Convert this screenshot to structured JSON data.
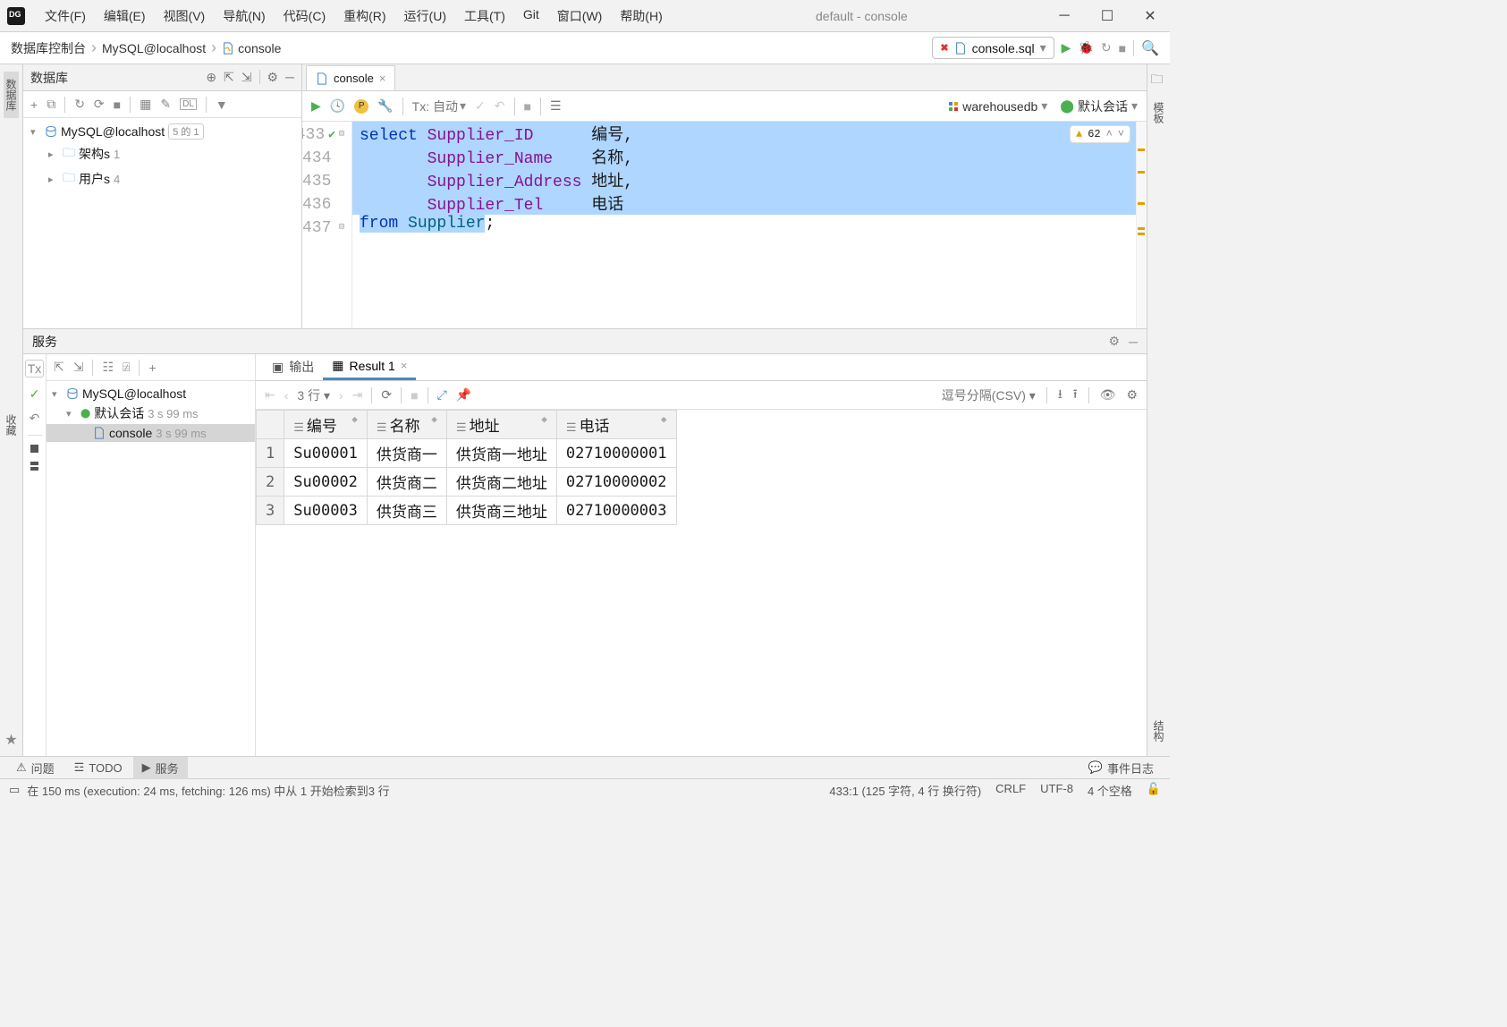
{
  "window": {
    "title": "default - console"
  },
  "menu": [
    "文件(F)",
    "编辑(E)",
    "视图(V)",
    "导航(N)",
    "代码(C)",
    "重构(R)",
    "运行(U)",
    "工具(T)",
    "Git",
    "窗口(W)",
    "帮助(H)"
  ],
  "breadcrumb": {
    "root": "数据库控制台",
    "db": "MySQL@localhost",
    "leaf": "console"
  },
  "file_dropdown": "console.sql",
  "left_rail": {
    "db": "数据库",
    "fav": "收藏"
  },
  "right_rail": {
    "tpl": "模板",
    "struct": "结构"
  },
  "db_panel": {
    "title": "数据库",
    "tree": {
      "conn": "MySQL@localhost",
      "conn_badge": "5 的 1",
      "schemas": "架构s",
      "schemas_count": "1",
      "users": "用户s",
      "users_count": "4"
    }
  },
  "editor": {
    "tab": "console",
    "tx_label": "Tx: 自动",
    "target_db": "warehousedb",
    "session": "默认会话",
    "warning_count": "62",
    "lines": {
      "l433": "433",
      "l434": "434",
      "l435": "435",
      "l436": "436",
      "l437": "437",
      "kw_select": "select",
      "c1": "Supplier_ID",
      "a1": "编号",
      "comma": ",",
      "c2": "Supplier_Name",
      "a2": "名称",
      "c3": "Supplier_Address",
      "a3": "地址",
      "c4": "Supplier_Tel",
      "a4": "电话",
      "kw_from": "from",
      "tbl": "Supplier",
      "semi": ";"
    }
  },
  "services": {
    "title": "服务",
    "output_tab": "输出",
    "result_tab": "Result 1",
    "rows_label": "3 行",
    "csv_label": "逗号分隔(CSV)",
    "tree": {
      "conn": "MySQL@localhost",
      "session": "默认会话",
      "session_time": "3 s 99 ms",
      "console": "console",
      "console_time": "3 s 99 ms"
    },
    "columns": [
      "编号",
      "名称",
      "地址",
      "电话"
    ],
    "rows": [
      {
        "n": "1",
        "id": "Su00001",
        "name": "供货商一",
        "addr": "供货商一地址",
        "tel": "02710000001"
      },
      {
        "n": "2",
        "id": "Su00002",
        "name": "供货商二",
        "addr": "供货商二地址",
        "tel": "02710000002"
      },
      {
        "n": "3",
        "id": "Su00003",
        "name": "供货商三",
        "addr": "供货商三地址",
        "tel": "02710000003"
      }
    ]
  },
  "bottom_tabs": {
    "problems": "问题",
    "todo": "TODO",
    "services": "服务",
    "eventlog": "事件日志"
  },
  "status": {
    "left": "在 150 ms (execution: 24 ms, fetching: 126 ms) 中从 1 开始检索到3 行",
    "pos": "433:1 (125 字符, 4 行 换行符)",
    "eol": "CRLF",
    "enc": "UTF-8",
    "indent": "4 个空格"
  }
}
